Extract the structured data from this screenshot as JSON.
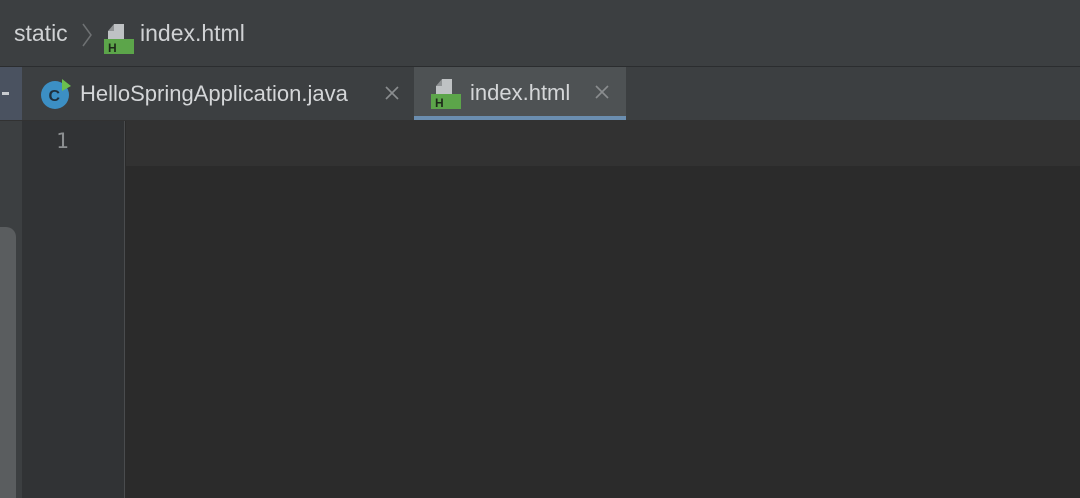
{
  "breadcrumb": {
    "folder": "static",
    "file": "index.html",
    "file_icon": "html-file-icon"
  },
  "tabs": [
    {
      "label": "HelloSpringApplication.java",
      "icon": "spring-boot-class-icon",
      "active": false
    },
    {
      "label": "index.html",
      "icon": "html-file-icon",
      "active": true
    }
  ],
  "editor": {
    "line_numbers": [
      "1"
    ]
  },
  "colors": {
    "background": "#2b2b2b",
    "toolbar": "#3c3f41",
    "active_tab": "#4e5254",
    "active_tab_underline": "#6b8eb0",
    "html_icon_green": "#5ca54a",
    "class_icon_blue": "#3c8fc4",
    "spring_green": "#6bbf4e"
  }
}
